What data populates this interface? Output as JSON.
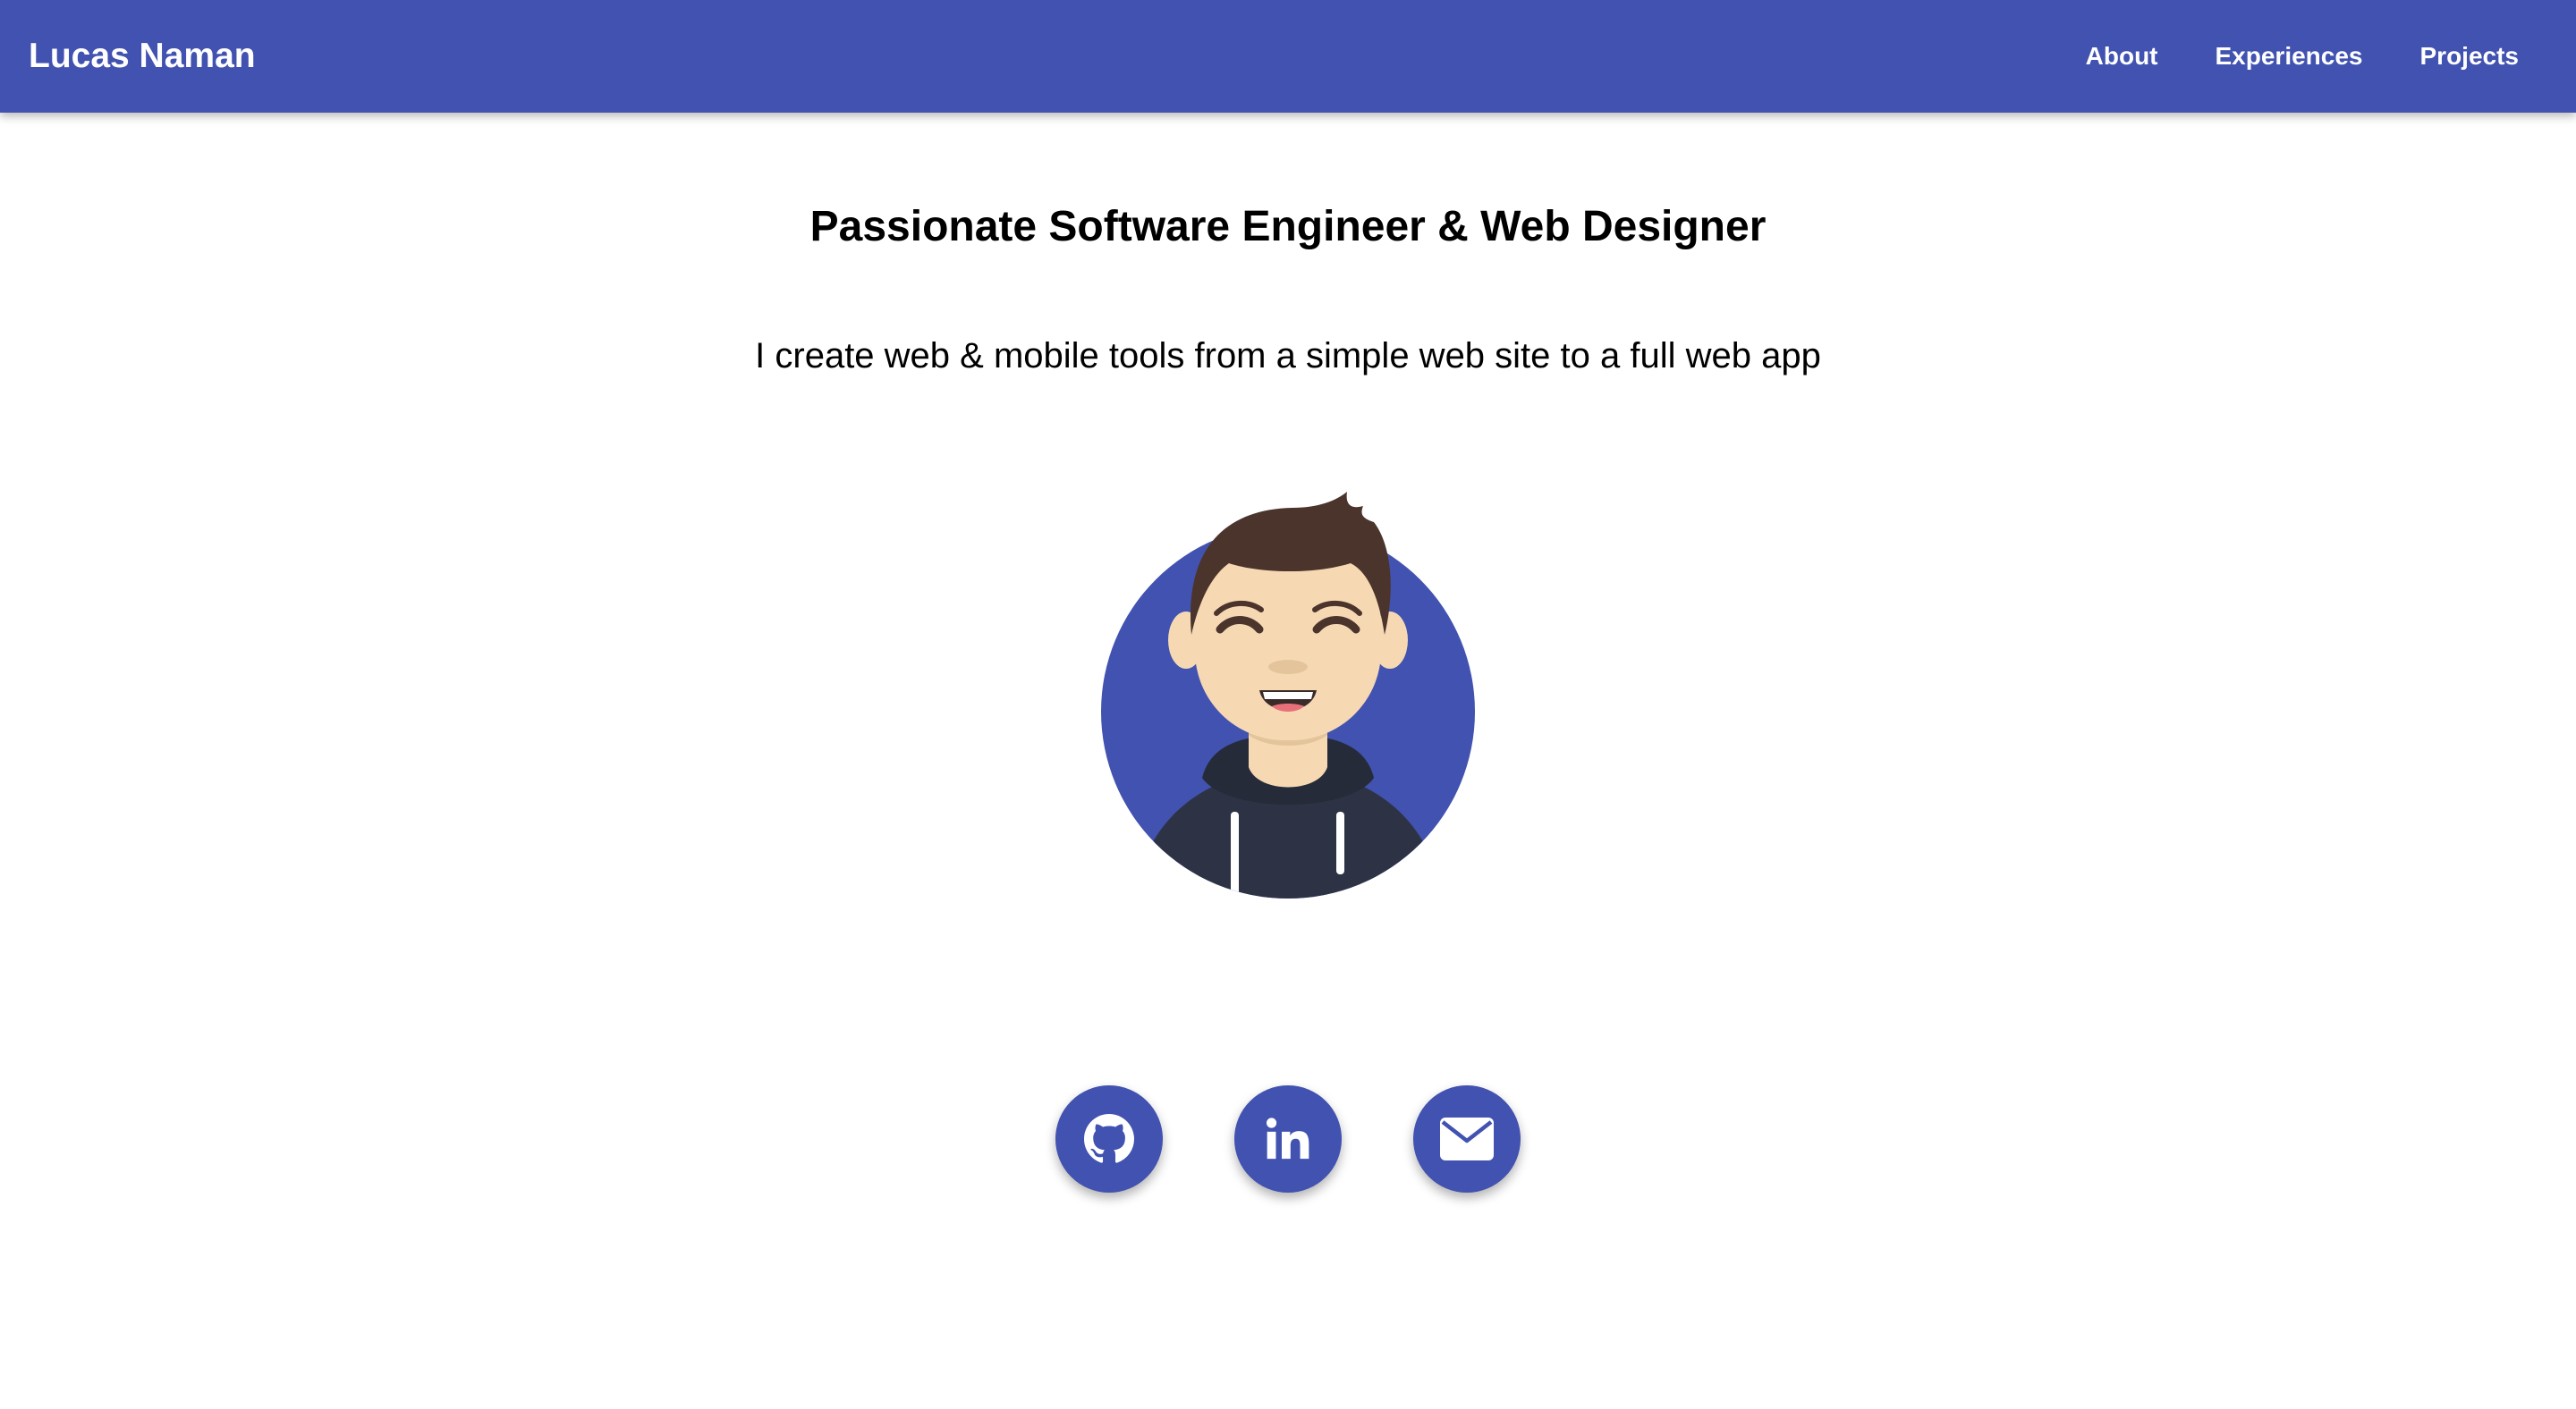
{
  "header": {
    "brand": "Lucas Naman",
    "nav": [
      {
        "label": "About"
      },
      {
        "label": "Experiences"
      },
      {
        "label": "Projects"
      }
    ],
    "background_color": "#4152b0"
  },
  "hero": {
    "headline": "Passionate Software Engineer & Web Designer",
    "subline": "I create web & mobile tools from a simple web site to a full web app",
    "avatar_icon": "cartoon-man-avatar"
  },
  "social": [
    {
      "icon": "github-icon"
    },
    {
      "icon": "linkedin-icon"
    },
    {
      "icon": "email-icon"
    }
  ],
  "colors": {
    "accent": "#4152b0",
    "text": "#000000",
    "background": "#ffffff"
  }
}
